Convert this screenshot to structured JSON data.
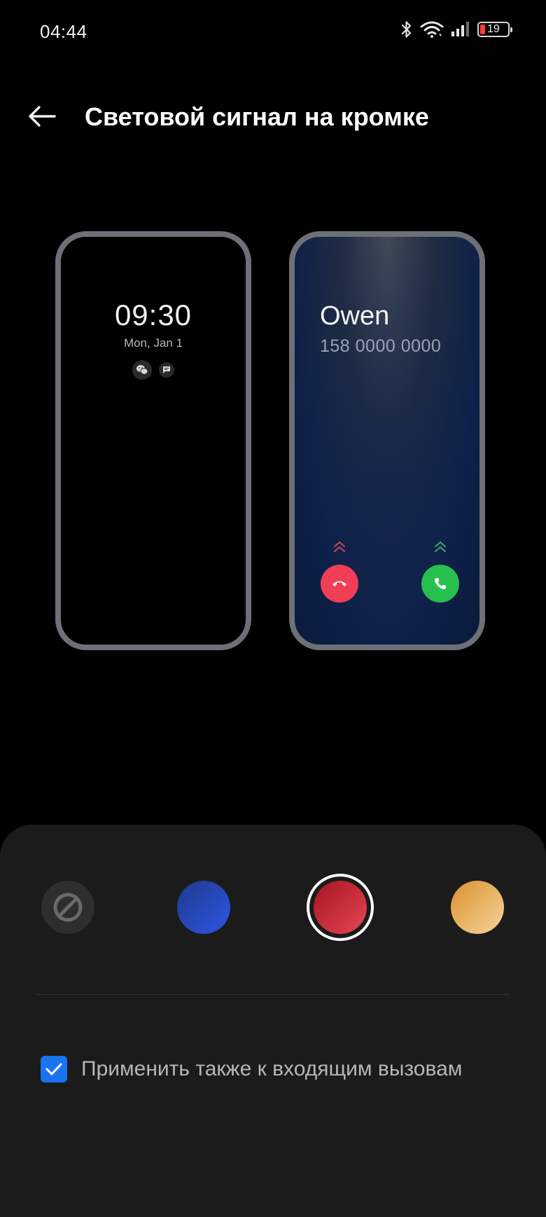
{
  "status_bar": {
    "time": "04:44",
    "battery": "19",
    "icons": [
      "bluetooth-icon",
      "wifi-icon",
      "signal-icon",
      "battery-icon"
    ]
  },
  "header": {
    "title": "Световой сигнал на кромке",
    "back_icon": "back-arrow-icon"
  },
  "preview_left": {
    "time": "09:30",
    "date": "Mon, Jan 1",
    "icons": [
      "wechat-icon",
      "message-icon"
    ]
  },
  "preview_right": {
    "caller_name": "Owen",
    "caller_number": "158 0000 0000",
    "decline_icon": "phone-hangup-icon",
    "accept_icon": "phone-icon",
    "decline_color": "#ef3e55",
    "accept_color": "#27c04f"
  },
  "colors": {
    "options": [
      {
        "id": "none",
        "icon": "no-entry-icon",
        "color": "#2e2e2e",
        "selected": false
      },
      {
        "id": "blue",
        "color": "#2f55e6",
        "selected": false
      },
      {
        "id": "red",
        "color": "#d42a3a",
        "selected": true
      },
      {
        "id": "gold",
        "color": "#f0b868",
        "selected": false
      }
    ]
  },
  "options": {
    "apply_to_calls_label": "Применить также к входящим вызовам",
    "apply_to_calls_checked": true,
    "checkbox_color": "#1a73f0"
  }
}
